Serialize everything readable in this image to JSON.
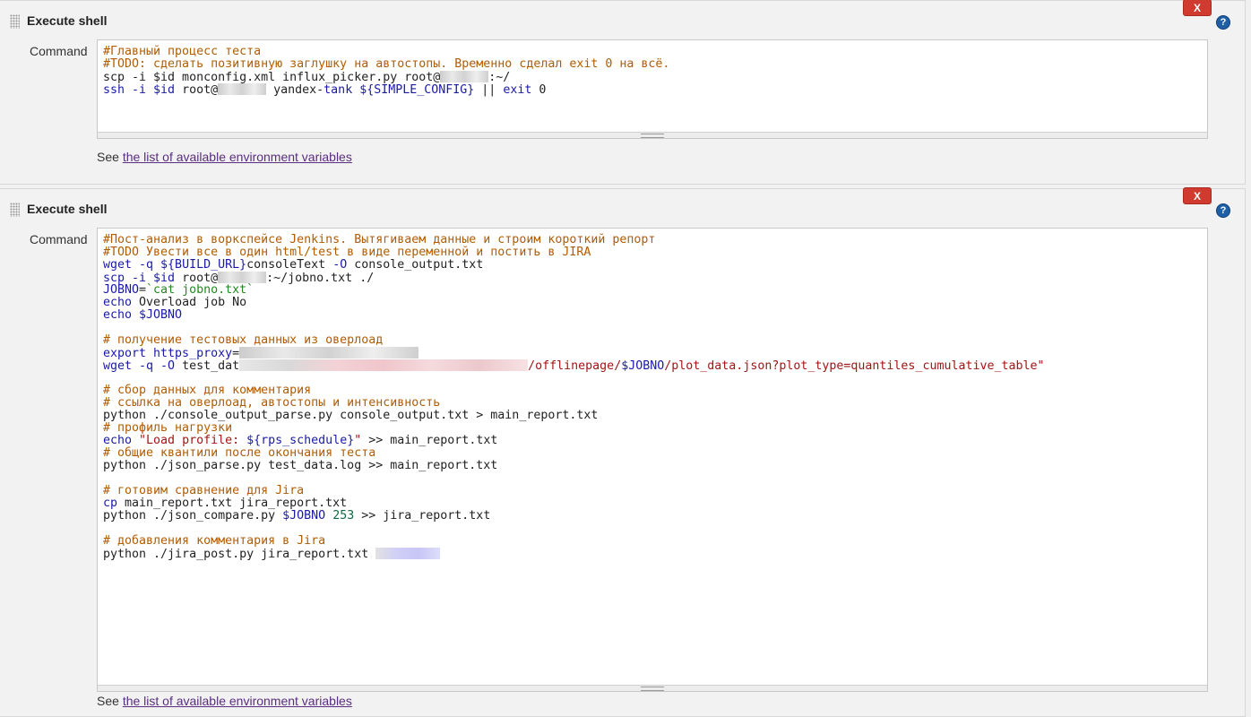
{
  "steps": [
    {
      "title": "Execute shell",
      "delete_label": "X",
      "help_label": "?",
      "command_label": "Command",
      "env_prefix": "See ",
      "env_link": "the list of available environment variables",
      "lines": [
        [
          {
            "t": "#Главный процесс теста",
            "c": "cm"
          }
        ],
        [
          {
            "t": "#TODO: сделать позитивную заглушку на автостопы. Временно сделал exit 0 на всё.",
            "c": "cm"
          }
        ],
        [
          {
            "t": "scp -i $id monconfig.xml influx_picker.py root@"
          },
          {
            "blur": "grey",
            "w": 54
          },
          {
            "t": ":~/"
          }
        ],
        [
          {
            "t": "ssh -i ",
            "c": "kw"
          },
          {
            "t": "$id",
            "c": "kw"
          },
          {
            "t": " root@"
          },
          {
            "blur": "grey",
            "w": 54
          },
          {
            "t": " yandex-"
          },
          {
            "t": "tank ${SIMPLE_CONFIG}",
            "c": "kw"
          },
          {
            "t": " || "
          },
          {
            "t": "exit",
            "c": "kw"
          },
          {
            "t": " 0"
          }
        ]
      ]
    },
    {
      "title": "Execute shell",
      "delete_label": "X",
      "help_label": "?",
      "command_label": "Command",
      "env_prefix": "See ",
      "env_link": "the list of available environment variables",
      "lines": [
        [
          {
            "t": "#Пост-анализ в воркспейсе Jenkins. Вытягиваем данные и строим короткий репорт",
            "c": "cm"
          }
        ],
        [
          {
            "t": "#TODO Увести все в один html/test в виде переменной и постить в JIRA",
            "c": "cm"
          }
        ],
        [
          {
            "t": "wget -q ",
            "c": "kw"
          },
          {
            "t": "${BUILD_URL}",
            "c": "kw"
          },
          {
            "t": "consoleText "
          },
          {
            "t": "-O",
            "c": "kw"
          },
          {
            "t": " console_output.txt"
          }
        ],
        [
          {
            "t": "scp -i ",
            "c": "kw"
          },
          {
            "t": "$id",
            "c": "kw"
          },
          {
            "t": " root@"
          },
          {
            "blur": "grey",
            "w": 54
          },
          {
            "t": ":~/jobno.txt ./"
          }
        ],
        [
          {
            "t": "JOBNO",
            "c": "kw"
          },
          {
            "t": "="
          },
          {
            "t": "`cat jobno.txt`",
            "c": "bt"
          }
        ],
        [
          {
            "t": "echo",
            "c": "kw"
          },
          {
            "t": " Overload job No"
          }
        ],
        [
          {
            "t": "echo ",
            "c": "kw"
          },
          {
            "t": "$JOBNO",
            "c": "kw"
          }
        ],
        [],
        [
          {
            "t": "# получение тестовых данных из оверлоад",
            "c": "cm"
          }
        ],
        [
          {
            "t": "export https_proxy",
            "c": "kw"
          },
          {
            "t": "="
          },
          {
            "blur": "grey",
            "w": 200
          }
        ],
        [
          {
            "t": "wget -q -O",
            "c": "kw"
          },
          {
            "t": " test_dat"
          },
          {
            "blur": "pink",
            "w": 322
          },
          {
            "t": "/offlinepage/",
            "c": "str"
          },
          {
            "t": "$JOBNO",
            "c": "kw"
          },
          {
            "t": "/plot_data.json?plot_type=quantiles_cumulative_table\"",
            "c": "str"
          }
        ],
        [],
        [
          {
            "t": "# сбор данных для комментария",
            "c": "cm"
          }
        ],
        [
          {
            "t": "# ссылка на оверлоад, автостопы и интенсивность",
            "c": "cm"
          }
        ],
        [
          {
            "t": "python ./console_output_parse.py console_output.txt > main_report.txt"
          }
        ],
        [
          {
            "t": "# профиль нагрузки",
            "c": "cm"
          }
        ],
        [
          {
            "t": "echo ",
            "c": "kw"
          },
          {
            "t": "\"Load profile: ",
            "c": "str"
          },
          {
            "t": "${rps_schedule}",
            "c": "kw"
          },
          {
            "t": "\"",
            "c": "str"
          },
          {
            "t": " >> main_report.txt"
          }
        ],
        [
          {
            "t": "# общие квантили после окончания теста",
            "c": "cm"
          }
        ],
        [
          {
            "t": "python ./json_parse.py test_data.log >> main_report.txt"
          }
        ],
        [],
        [
          {
            "t": "# готовим сравнение для Jira",
            "c": "cm"
          }
        ],
        [
          {
            "t": "cp",
            "c": "kw"
          },
          {
            "t": " main_report.txt jira_report.txt"
          }
        ],
        [
          {
            "t": "python ./json_compare.py "
          },
          {
            "t": "$JOBNO",
            "c": "kw"
          },
          {
            "t": " 253",
            "c": "num"
          },
          {
            "t": " >> jira_report.txt"
          }
        ],
        [],
        [
          {
            "t": "# добавления комментария в Jira",
            "c": "cm"
          }
        ],
        [
          {
            "t": "python ./jira_post.py jira_report.txt "
          },
          {
            "blur": "lilac",
            "w": 72
          }
        ]
      ]
    }
  ]
}
